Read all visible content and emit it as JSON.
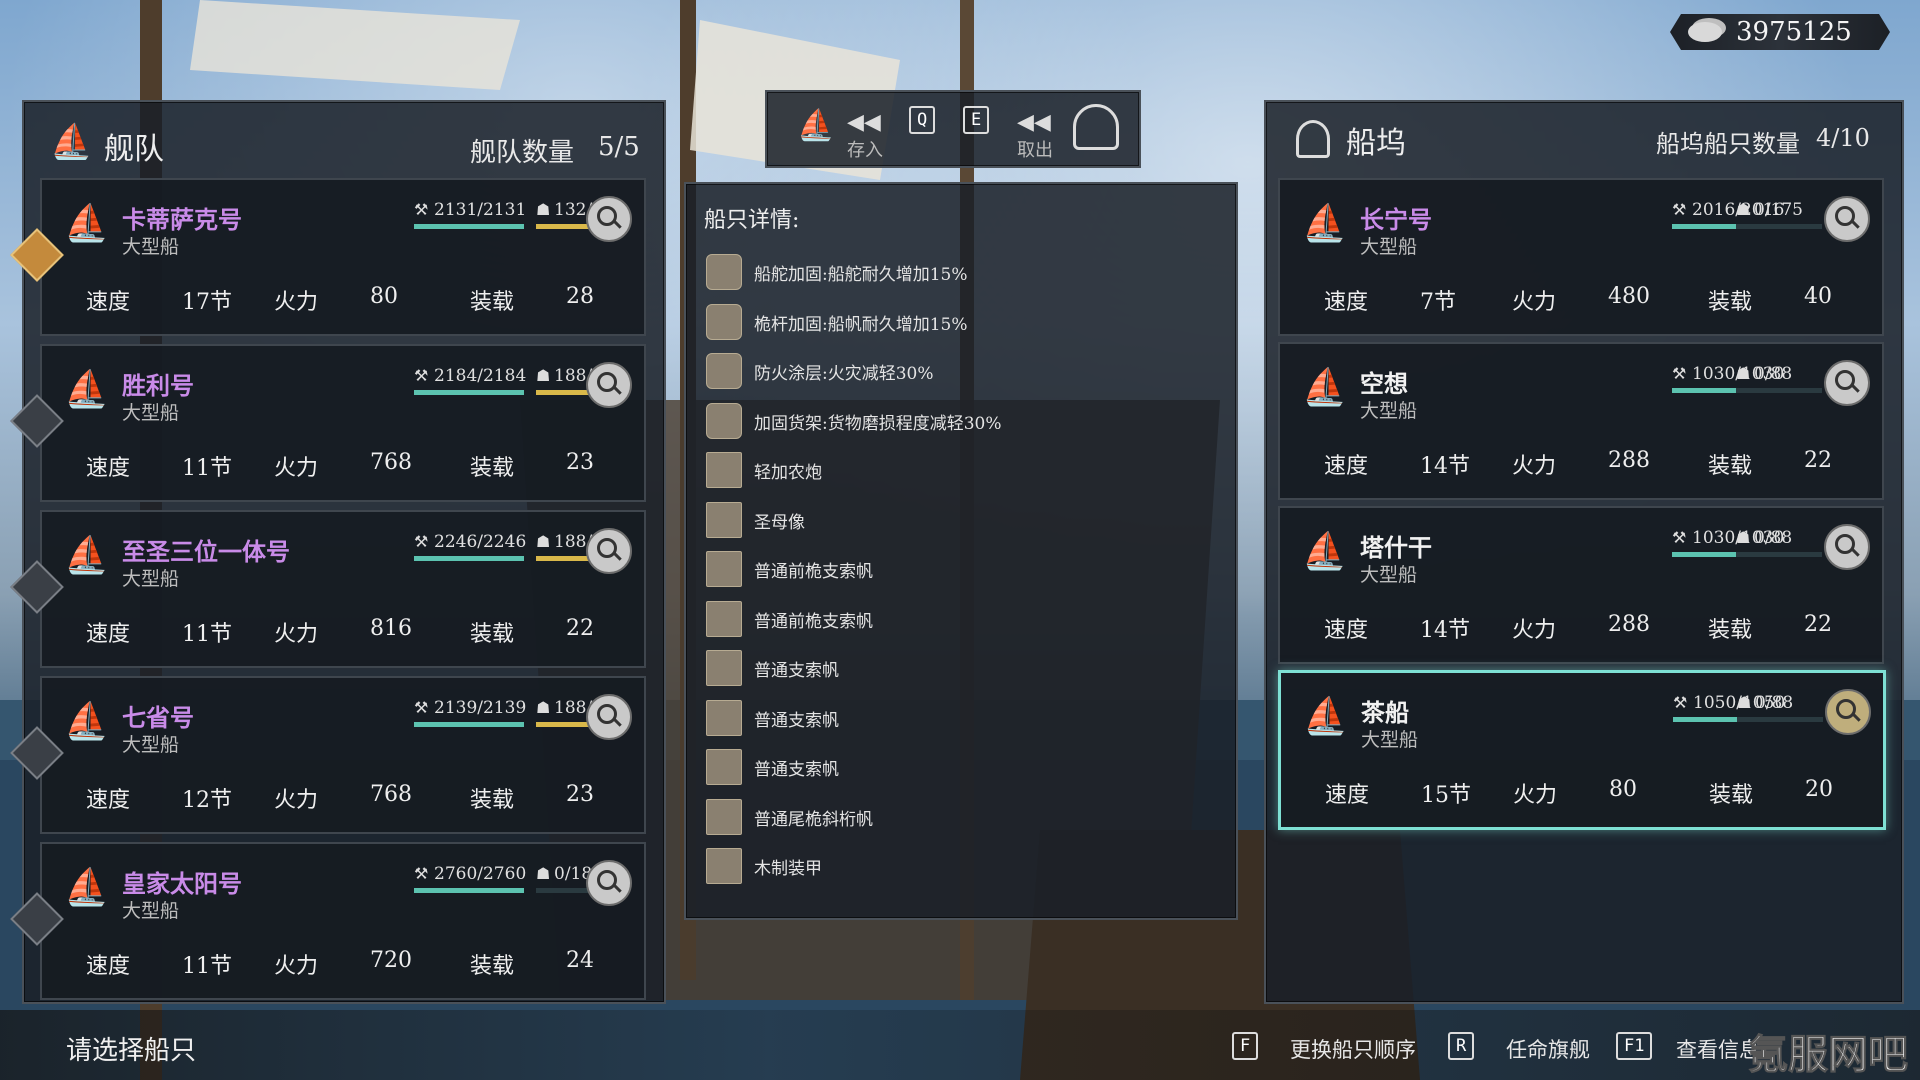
{
  "currency": {
    "icon": "coin-stack-icon",
    "amount": "3975125"
  },
  "fleet": {
    "title": "舰队",
    "count_label": "舰队数量",
    "count": "5/5",
    "ships": [
      {
        "name": "卡蒂萨克号",
        "type": "大型船",
        "durability": "2131/2131",
        "crew": "132/132",
        "hull_fill": 1.0,
        "crew_fill": 1.0,
        "speed_label": "速度",
        "speed": "17节",
        "fire_label": "火力",
        "fire": "80",
        "cargo_label": "装载",
        "cargo": "28",
        "flagship": true
      },
      {
        "name": "胜利号",
        "type": "大型船",
        "durability": "2184/2184",
        "crew": "188/188",
        "hull_fill": 1.0,
        "crew_fill": 1.0,
        "speed_label": "速度",
        "speed": "11节",
        "fire_label": "火力",
        "fire": "768",
        "cargo_label": "装载",
        "cargo": "23",
        "flagship": false
      },
      {
        "name": "至圣三位一体号",
        "type": "大型船",
        "durability": "2246/2246",
        "crew": "188/188",
        "hull_fill": 1.0,
        "crew_fill": 1.0,
        "speed_label": "速度",
        "speed": "11节",
        "fire_label": "火力",
        "fire": "816",
        "cargo_label": "装载",
        "cargo": "22",
        "flagship": false
      },
      {
        "name": "七省号",
        "type": "大型船",
        "durability": "2139/2139",
        "crew": "188/188",
        "hull_fill": 1.0,
        "crew_fill": 1.0,
        "speed_label": "速度",
        "speed": "12节",
        "fire_label": "火力",
        "fire": "768",
        "cargo_label": "装载",
        "cargo": "23",
        "flagship": false
      },
      {
        "name": "皇家太阳号",
        "type": "大型船",
        "durability": "2760/2760",
        "crew": "0/188",
        "hull_fill": 1.0,
        "crew_fill": 0.0,
        "speed_label": "速度",
        "speed": "11节",
        "fire_label": "火力",
        "fire": "720",
        "cargo_label": "装载",
        "cargo": "24",
        "flagship": false
      }
    ]
  },
  "transfer": {
    "deposit_label": "存入",
    "withdraw_label": "取出",
    "key_q": "Q",
    "key_e": "E"
  },
  "details": {
    "title": "船只详情:",
    "items": [
      {
        "icon": "upgrade-badge-icon",
        "text": "船舵加固:船舵耐久增加15%"
      },
      {
        "icon": "upgrade-badge-icon",
        "text": "桅杆加固:船帆耐久增加15%"
      },
      {
        "icon": "upgrade-badge-icon",
        "text": "防火涂层:火灾减轻30%"
      },
      {
        "icon": "upgrade-badge-icon",
        "text": "加固货架:货物磨损程度减轻30%"
      },
      {
        "icon": "cannon-icon",
        "text": "轻加农炮"
      },
      {
        "icon": "figurehead-icon",
        "text": "圣母像"
      },
      {
        "icon": "sail-icon",
        "text": "普通前桅支索帆"
      },
      {
        "icon": "sail-icon",
        "text": "普通前桅支索帆"
      },
      {
        "icon": "sail-icon",
        "text": "普通支索帆"
      },
      {
        "icon": "sail-icon",
        "text": "普通支索帆"
      },
      {
        "icon": "sail-icon",
        "text": "普通支索帆"
      },
      {
        "icon": "mizzen-sail-icon",
        "text": "普通尾桅斜桁帆"
      },
      {
        "icon": "armor-icon",
        "text": "木制装甲"
      }
    ]
  },
  "dock": {
    "title": "船坞",
    "count_label": "船坞船只数量",
    "count": "4/10",
    "ships": [
      {
        "name": "长宁号",
        "type": "大型船",
        "durability": "2016/2016",
        "crew": "0/175",
        "hull_fill": 1.0,
        "crew_fill": 0.0,
        "speed_label": "速度",
        "speed": "7节",
        "fire_label": "火力",
        "fire": "480",
        "cargo_label": "装载",
        "cargo": "40",
        "purple": true
      },
      {
        "name": "空想",
        "type": "大型船",
        "durability": "1030/1030",
        "crew": "0/88",
        "hull_fill": 1.0,
        "crew_fill": 0.0,
        "speed_label": "速度",
        "speed": "14节",
        "fire_label": "火力",
        "fire": "288",
        "cargo_label": "装载",
        "cargo": "22",
        "purple": false
      },
      {
        "name": "塔什干",
        "type": "大型船",
        "durability": "1030/1030",
        "crew": "0/88",
        "hull_fill": 1.0,
        "crew_fill": 0.0,
        "speed_label": "速度",
        "speed": "14节",
        "fire_label": "火力",
        "fire": "288",
        "cargo_label": "装载",
        "cargo": "22",
        "purple": false
      },
      {
        "name": "茶船",
        "type": "大型船",
        "durability": "1050/1050",
        "crew": "0/88",
        "hull_fill": 1.0,
        "crew_fill": 0.0,
        "speed_label": "速度",
        "speed": "15节",
        "fire_label": "火力",
        "fire": "80",
        "cargo_label": "装载",
        "cargo": "20",
        "purple": false,
        "selected": true
      }
    ]
  },
  "footer": {
    "prompt": "请选择船只",
    "hints": [
      {
        "key": "F",
        "label": "更换船只顺序"
      },
      {
        "key": "R",
        "label": "任命旗舰"
      },
      {
        "key": "F1",
        "label": "查看信息"
      }
    ],
    "watermark": "氪服网吧"
  }
}
